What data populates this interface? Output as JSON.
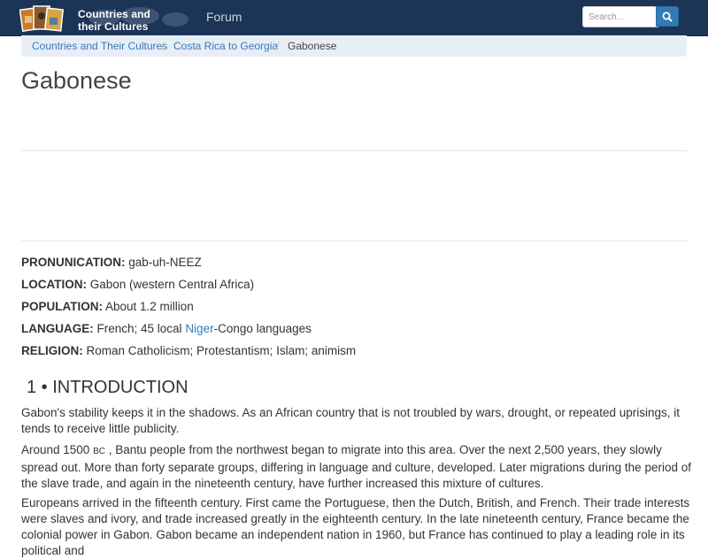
{
  "header": {
    "logo_line1": "Countries and",
    "logo_line2": "their Cultures",
    "nav_forum": "Forum",
    "search_placeholder": "Search..."
  },
  "breadcrumb": [
    {
      "label": "Countries and Their Cultures"
    },
    {
      "label": "Costa Rica to Georgia"
    },
    {
      "label": "Gabonese"
    }
  ],
  "page": {
    "title": "Gabonese"
  },
  "facts": {
    "pronunciation": {
      "label": "PRONUNICATION:",
      "value": " gab-uh-NEEZ"
    },
    "location": {
      "label": "LOCATION:",
      "value": " Gabon (western Central Africa)"
    },
    "population": {
      "label": "POPULATION:",
      "value": " About 1.2 million"
    },
    "language": {
      "label": "LANGUAGE:",
      "value_pre": " French; 45 local ",
      "link": "Niger",
      "value_post": "-Congo languages"
    },
    "religion": {
      "label": "RELIGION:",
      "value": " Roman Catholicism; Protestantism; Islam; animism"
    }
  },
  "section": {
    "heading": "1 • INTRODUCTION",
    "p1": "Gabon's stability keeps it in the shadows. As an African country that is not troubled by wars, drought, or repeated uprisings, it tends to receive little publicity.",
    "p2_pre": "Around 1500 ",
    "p2_bc": "BC",
    "p2_post": " , Bantu people from the northwest began to migrate into this area. Over the next 2,500 years, they slowly spread out. More than forty separate groups, differing in language and culture, developed. Later migrations during the period of the slave trade, and again in the nineteenth century, have further increased this mixture of cultures.",
    "p3": "Europeans arrived in the fifteenth century. First came the Portuguese, then the Dutch, British, and French. Their trade interests were slaves and ivory, and trade increased greatly in the eighteenth century. In the late nineteenth century, France became the colonial power in Gabon. Gabon became an independent nation in 1960, but France has continued to play a leading role in its political and"
  }
}
